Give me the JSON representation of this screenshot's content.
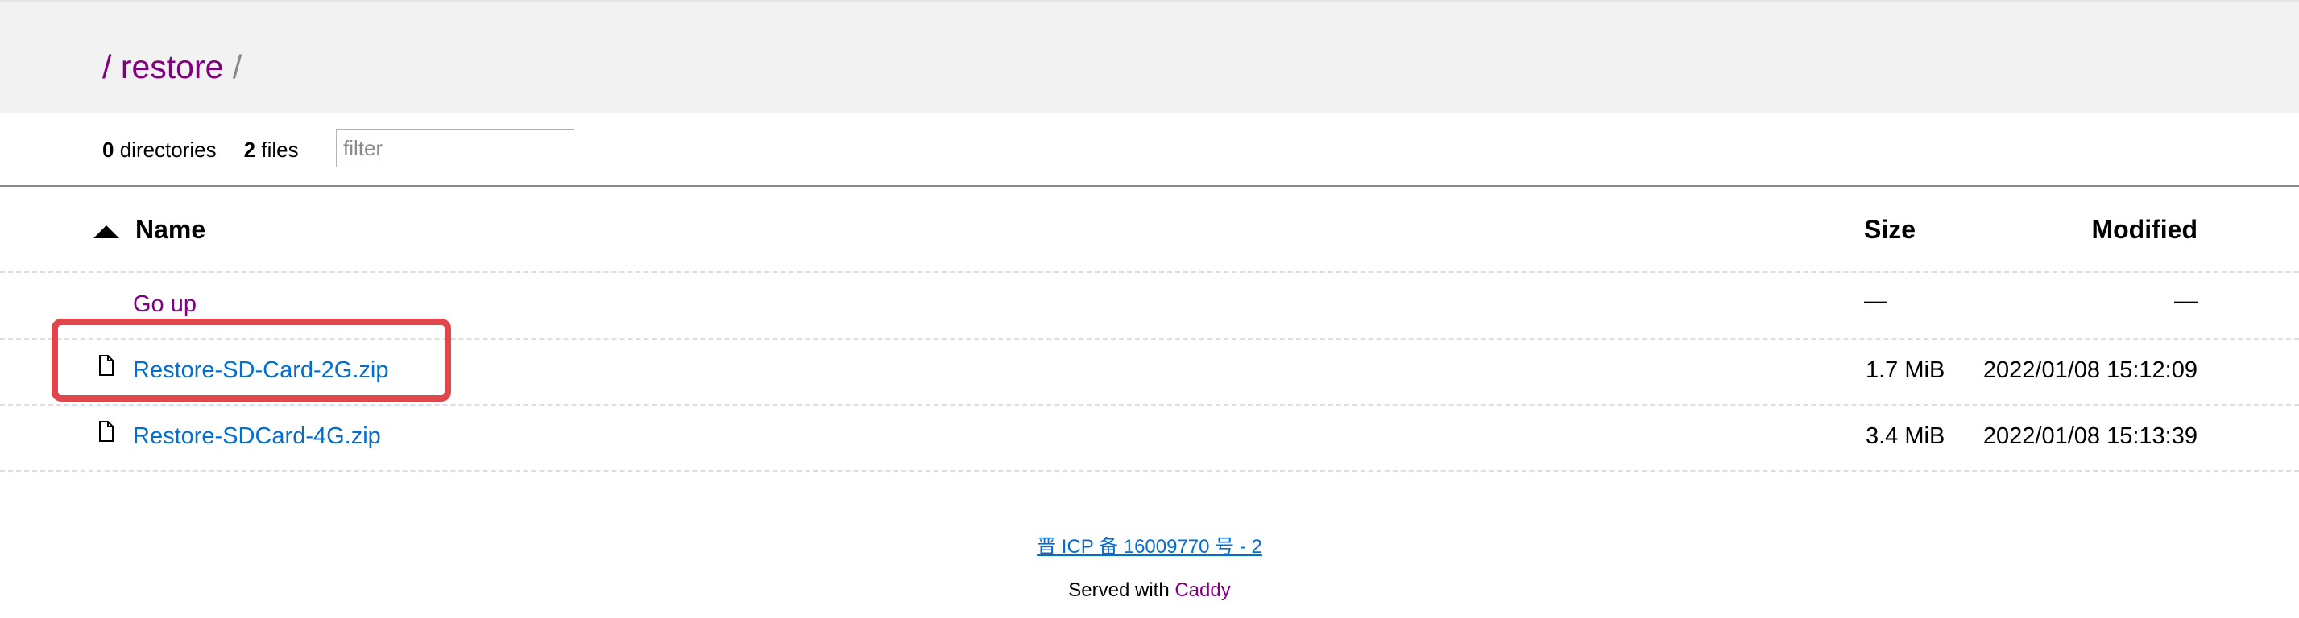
{
  "breadcrumb": {
    "root_slash": "/",
    "folder": "restore",
    "trailing_slash": "/"
  },
  "summary": {
    "directories_count": "0",
    "directories_label": "directories",
    "files_count": "2",
    "files_label": "files"
  },
  "filter": {
    "placeholder": "filter",
    "value": ""
  },
  "table": {
    "columns": {
      "name": "Name",
      "size": "Size",
      "modified": "Modified"
    },
    "go_up": {
      "label": "Go up",
      "size": "—",
      "modified": "—"
    },
    "rows": [
      {
        "icon": "file-icon",
        "name": "Restore-SD-Card-2G.zip",
        "size": "1.7 MiB",
        "modified": "2022/01/08 15:12:09"
      },
      {
        "icon": "file-icon",
        "name": "Restore-SDCard-4G.zip",
        "size": "3.4 MiB",
        "modified": "2022/01/08 15:13:39"
      }
    ]
  },
  "footer": {
    "icp": "晋 ICP 备 16009770 号 - 2",
    "served_prefix": "Served with",
    "served_link": "Caddy"
  },
  "colors": {
    "visited_link": "#800080",
    "link": "#006ed3",
    "highlight": "#e0464b",
    "header_bg": "#f2f2f2"
  }
}
